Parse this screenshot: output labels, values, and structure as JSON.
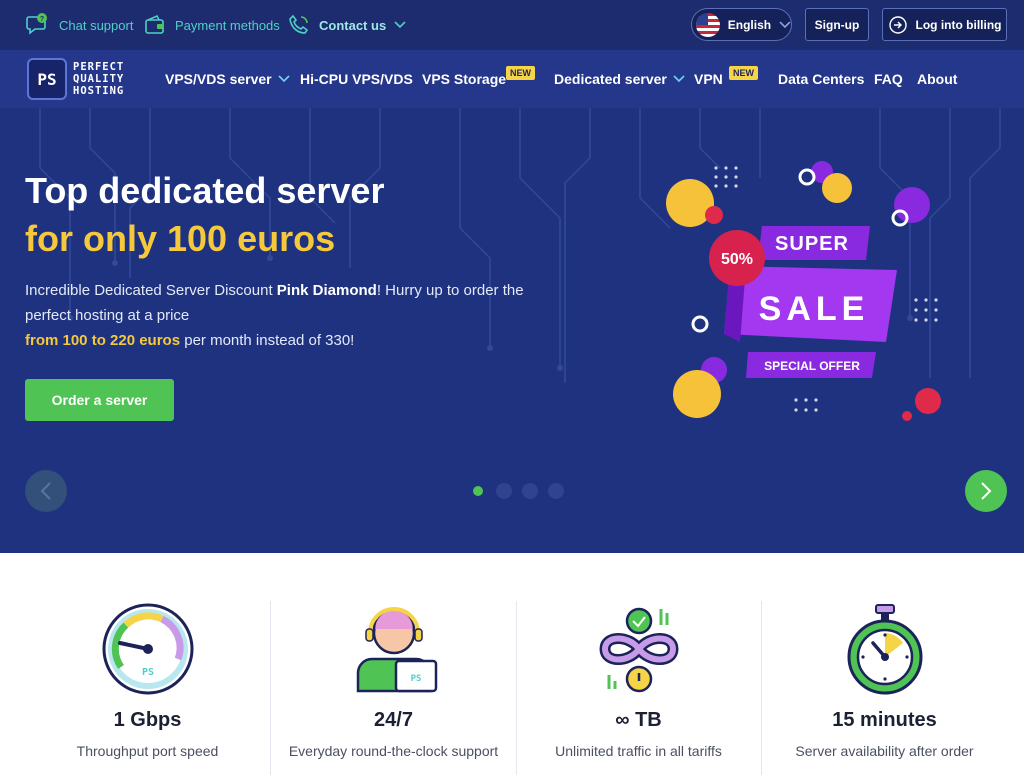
{
  "topbar": {
    "chat_support": "Chat support",
    "payment_methods": "Payment methods",
    "contact_us": "Contact us",
    "language": "English",
    "signup": "Sign-up",
    "login": "Log into billing"
  },
  "logo": {
    "mark": "PS",
    "line1": "PERFECT",
    "line2": "QUALITY",
    "line3": "HOSTING"
  },
  "nav": {
    "items": [
      {
        "label": "VPS/VDS server"
      },
      {
        "label": "Hi-CPU VPS/VDS"
      },
      {
        "label": "VPS Storage",
        "badge": "NEW"
      },
      {
        "label": "Dedicated server"
      },
      {
        "label": "VPN",
        "badge": "NEW"
      },
      {
        "label": "Data Centers"
      },
      {
        "label": "FAQ"
      },
      {
        "label": "About"
      }
    ]
  },
  "hero": {
    "title_line1": "Top dedicated server",
    "title_line2": "for only 100 euros",
    "desc_part1": "Incredible Dedicated Server Discount ",
    "desc_bold": "Pink Diamond",
    "desc_part2": "! Hurry up to order the perfect hosting at a price",
    "desc_highlight": "from 100 to 220 euros",
    "desc_part3": " per month instead of 330!",
    "cta": "Order a server",
    "promo_badge": "50%",
    "promo_super": "SUPER",
    "promo_sale": "SALE",
    "promo_special": "SPECIAL OFFER",
    "slides_total": 4,
    "slide_active": 1
  },
  "features": [
    {
      "title": "1 Gbps",
      "subtitle": "Throughput port speed",
      "icon": "speedometer-icon"
    },
    {
      "title": "24/7",
      "subtitle": "Everyday round-the-clock support",
      "icon": "support-agent-icon"
    },
    {
      "title": "∞ TB",
      "subtitle": "Unlimited traffic in all tariffs",
      "icon": "infinity-traffic-icon"
    },
    {
      "title": "15 minutes",
      "subtitle": "Server availability after order",
      "icon": "stopwatch-icon"
    }
  ],
  "colors": {
    "topbar": "#1c2c6e",
    "navbar": "#24378a",
    "hero": "#1e3280",
    "accent_green": "#50c355",
    "accent_yellow": "#f5c93b",
    "teal": "#4fd0c7",
    "promo_purple": "#8a2ae0"
  }
}
